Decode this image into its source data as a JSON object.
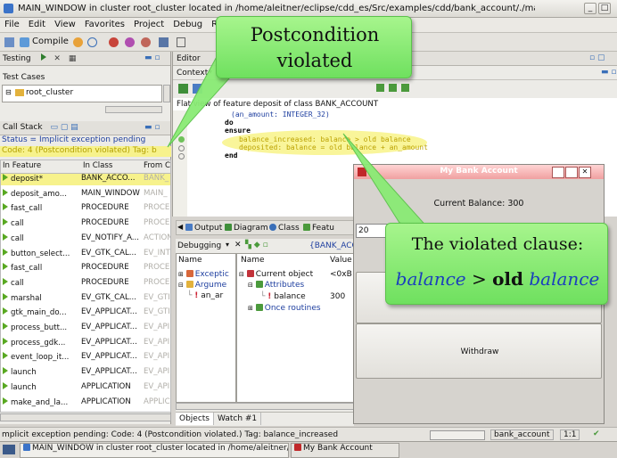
{
  "window": {
    "title": "MAIN_WINDOW  in cluster root_cluster   located in /home/aleitner/eclipse/cdd_es/Src/examples/cdd/bank_account/./main_wi",
    "controls": [
      "_",
      "□"
    ]
  },
  "menu": [
    "File",
    "Edit",
    "View",
    "Favorites",
    "Project",
    "Debug",
    "Refac"
  ],
  "toolbar": {
    "compile_label": "Compile"
  },
  "testing_panel": {
    "title": "Testing",
    "subheader": "Test Cases",
    "tree_item": "root_cluster"
  },
  "editor": {
    "tab": "Editor",
    "context_tab": "Context",
    "flat_view_label": "Flat view of feature deposit of class BANK_ACCOUNT",
    "code_lines": [
      "(an_amount: INTEGER_32)",
      "do",
      "ensure",
      "balance_increased: balance > old balance",
      "deposited: balance = old balance + an_amount",
      "end"
    ]
  },
  "callstack": {
    "title": "Call Stack",
    "status": "Status = Implicit exception pending",
    "code": "Code: 4 (Postcondition violated) Tag: b",
    "headers": [
      "In Feature",
      "In Class",
      "From C"
    ],
    "rows": [
      [
        "deposit*",
        "BANK_ACCO...",
        "BANK_"
      ],
      [
        "deposit_amo...",
        "MAIN_WINDOW",
        "MAIN_"
      ],
      [
        "fast_call",
        "PROCEDURE",
        "PROCE"
      ],
      [
        "call",
        "PROCEDURE",
        "PROCE"
      ],
      [
        "call",
        "EV_NOTIFY_A...",
        "ACTION"
      ],
      [
        "button_select...",
        "EV_GTK_CAL...",
        "EV_INT"
      ],
      [
        "fast_call",
        "PROCEDURE",
        "PROCE"
      ],
      [
        "call",
        "PROCEDURE",
        "PROCE"
      ],
      [
        "marshal",
        "EV_GTK_CAL...",
        "EV_GTI"
      ],
      [
        "gtk_main_do...",
        "EV_APPLICAT...",
        "EV_GTI"
      ],
      [
        "process_butt...",
        "EV_APPLICAT...",
        "EV_API"
      ],
      [
        "process_gdk...",
        "EV_APPLICAT...",
        "EV_API"
      ],
      [
        "event_loop_it...",
        "EV_APPLICAT...",
        "EV_API"
      ],
      [
        "launch",
        "EV_APPLICAT...",
        "EV_API"
      ],
      [
        "launch",
        "APPLICATION",
        "EV_API"
      ],
      [
        "make_and_la...",
        "APPLICATION",
        "APPLIC"
      ]
    ]
  },
  "bottom_tabs": [
    "Output",
    "Diagram",
    "Class",
    "Featu"
  ],
  "debugging": {
    "title": "Debugging",
    "class_ref": "{BANK_ACC",
    "left_header": "Name",
    "left_items": [
      "Exceptic",
      "Argume",
      "an_ar"
    ],
    "headers": [
      "Name",
      "Value"
    ],
    "items": [
      [
        "Current object",
        "<0xB"
      ],
      [
        "Attributes",
        ""
      ],
      [
        "balance",
        "300"
      ],
      [
        "Once routines",
        ""
      ]
    ],
    "tabs": [
      "Objects",
      "Watch #1"
    ]
  },
  "bank_dialog": {
    "title": "My Bank Account",
    "balance_label": "Current Balance: 300",
    "input_value": "20",
    "withdraw_label": "Withdraw"
  },
  "callouts": {
    "postcondition": "Postcondition violated",
    "violated_clause_title": "The violated clause:",
    "clause_var": "balance",
    "clause_op": ">",
    "clause_old": "old",
    "clause_var2": "balance"
  },
  "statusbar": {
    "message": "mplicit exception pending: Code: 4 (Postcondition violated.) Tag: balance_increased",
    "cluster": "bank_account",
    "position": "1:1"
  },
  "taskbar": {
    "item1": "MAIN_WINDOW  in cluster root_cluster   located in /home/aleitner/e...",
    "item2": "My Bank Account"
  },
  "colors": {
    "highlight": "#f7f28c",
    "callout_green": "#7ee86a",
    "clause_blue": "#1a3fbd"
  }
}
